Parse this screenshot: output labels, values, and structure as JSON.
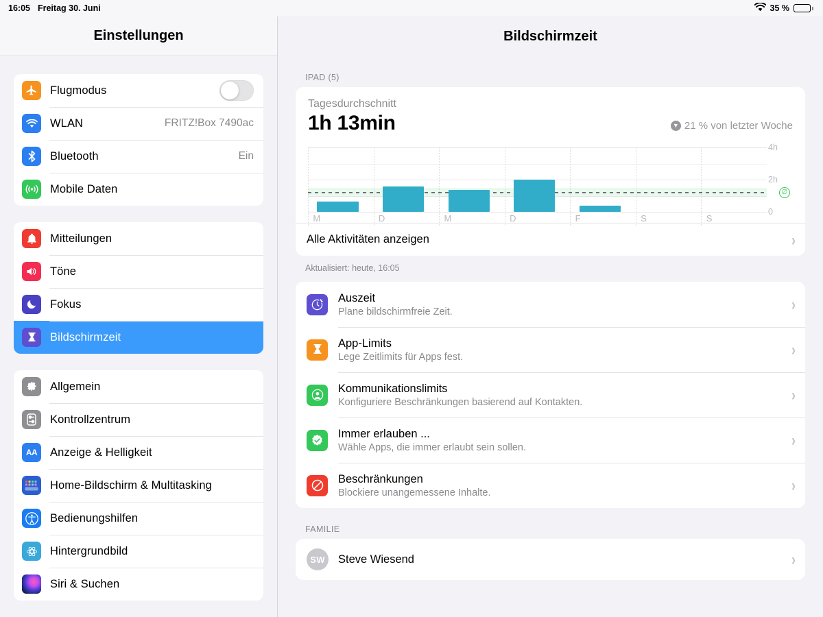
{
  "statusbar": {
    "time": "16:05",
    "date": "Freitag 30. Juni",
    "wifi_icon": "wifi-icon",
    "battery_percent": "35 %",
    "battery_level": 35
  },
  "sidebar": {
    "title": "Einstellungen",
    "groups": [
      {
        "items": [
          {
            "label": "Flugmodus",
            "icon": "airplane-icon",
            "color": "#f6921e",
            "control": "toggle",
            "toggle_on": false
          },
          {
            "label": "WLAN",
            "icon": "wifi-icon",
            "color": "#2b7ff0",
            "value": "FRITZ!Box 7490ac"
          },
          {
            "label": "Bluetooth",
            "icon": "bluetooth-icon",
            "color": "#2b7ff0",
            "value": "Ein"
          },
          {
            "label": "Mobile Daten",
            "icon": "cellular-icon",
            "color": "#34c759",
            "value": ""
          }
        ]
      },
      {
        "items": [
          {
            "label": "Mitteilungen",
            "icon": "bell-icon",
            "color": "#ef3b30"
          },
          {
            "label": "Töne",
            "icon": "speaker-icon",
            "color": "#f42d52"
          },
          {
            "label": "Fokus",
            "icon": "moon-icon",
            "color": "#4a40c4"
          },
          {
            "label": "Bildschirmzeit",
            "icon": "hourglass-icon",
            "color": "#5d4fd0",
            "selected": true
          }
        ]
      },
      {
        "items": [
          {
            "label": "Allgemein",
            "icon": "gear-icon",
            "color": "#8e8e93"
          },
          {
            "label": "Kontrollzentrum",
            "icon": "sliders-icon",
            "color": "#8e8e93"
          },
          {
            "label": "Anzeige & Helligkeit",
            "icon": "text-size-icon",
            "color": "#2b7ff0"
          },
          {
            "label": "Home-Bildschirm & Multitasking",
            "icon": "app-grid-icon",
            "color": "#2b5fd0"
          },
          {
            "label": "Bedienungshilfen",
            "icon": "accessibility-icon",
            "color": "#1a7cf0"
          },
          {
            "label": "Hintergrundbild",
            "icon": "wallpaper-icon",
            "color": "#3aa8d8"
          },
          {
            "label": "Siri & Suchen",
            "icon": "siri-icon",
            "color": "#1b1b2b"
          }
        ]
      }
    ]
  },
  "main": {
    "title": "Bildschirmzeit",
    "device_section_label": "IPAD (5)",
    "summary": {
      "daily_average_label": "Tagesdurchschnitt",
      "daily_average_value": "1h 13min",
      "delta_text": "21 % von letzter Woche",
      "delta_direction": "down",
      "delta_icon": "arrow-down-circle-icon"
    },
    "all_activity_label": "Alle Aktivitäten anzeigen",
    "updated_label": "Aktualisiert: heute, 16:05",
    "features": [
      {
        "title": "Auszeit",
        "subtitle": "Plane bildschirmfreie Zeit.",
        "icon": "downtime-clock-icon",
        "color": "#5d4fd0"
      },
      {
        "title": "App-Limits",
        "subtitle": "Lege Zeitlimits für Apps fest.",
        "icon": "hourglass-icon",
        "color": "#f6921e"
      },
      {
        "title": "Kommunikationslimits",
        "subtitle": "Konfiguriere Beschränkungen basierend auf Kontakten.",
        "icon": "person-circle-icon",
        "color": "#34c759"
      },
      {
        "title": "Immer erlauben ...",
        "subtitle": "Wähle Apps, die immer erlaubt sein sollen.",
        "icon": "check-badge-icon",
        "color": "#34c759"
      },
      {
        "title": "Beschränkungen",
        "subtitle": "Blockiere unangemessene Inhalte.",
        "icon": "no-entry-icon",
        "color": "#f03c2e"
      }
    ],
    "family_section_label": "FAMILIE",
    "family": [
      {
        "name": "Steve Wiesend",
        "initials": "SW"
      }
    ]
  },
  "chart_data": {
    "type": "bar",
    "title": "Tagesdurchschnitt",
    "categories": [
      "M",
      "D",
      "M",
      "D",
      "F",
      "S",
      "S"
    ],
    "values": [
      0.64,
      1.57,
      1.36,
      2.0,
      0.38,
      0,
      0
    ],
    "unit": "hours",
    "ylabel": "",
    "xlabel": "",
    "ylim": [
      0,
      4
    ],
    "yticks": [
      0,
      2,
      4
    ],
    "ytick_labels": [
      "0",
      "2h",
      "4h"
    ],
    "average_line": 1.22,
    "average_label": "∅",
    "bar_color": "#32adc9",
    "average_line_color": "#6f6f74",
    "grid": true,
    "legend": "none"
  }
}
